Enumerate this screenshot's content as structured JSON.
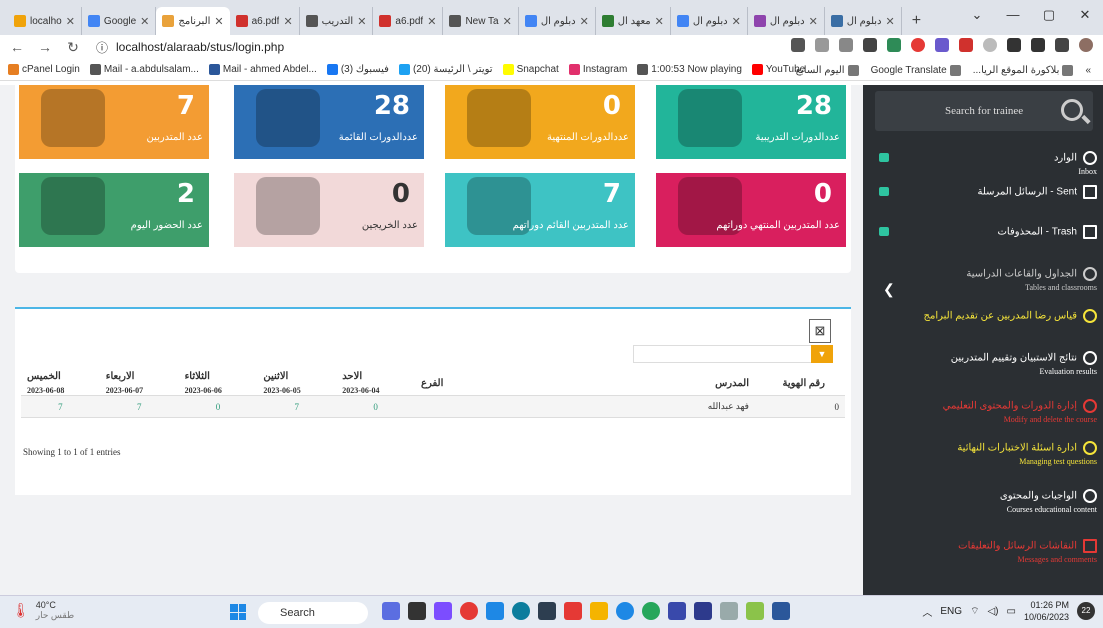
{
  "browser": {
    "tabs": [
      {
        "label": "localho",
        "color": "#f0a30a",
        "active": false
      },
      {
        "label": "Google",
        "color": "#4285f4",
        "active": false
      },
      {
        "label": "البرنامج",
        "color": "#e9a23b",
        "active": true
      },
      {
        "label": "a6.pdf",
        "color": "#d0312d",
        "active": false
      },
      {
        "label": "التدريب",
        "color": "#555",
        "active": false
      },
      {
        "label": "a6.pdf",
        "color": "#d0312d",
        "active": false
      },
      {
        "label": "New Ta",
        "color": "#555",
        "active": false
      },
      {
        "label": "دبلوم ال",
        "color": "#4285f4",
        "active": false
      },
      {
        "label": "معهد ال",
        "color": "#2e7d32",
        "active": false
      },
      {
        "label": "دبلوم ال",
        "color": "#4285f4",
        "active": false
      },
      {
        "label": "دبلوم ال",
        "color": "#8e44ad",
        "active": false
      },
      {
        "label": "دبلوم ال",
        "color": "#3a6ea5",
        "active": false
      }
    ],
    "new_tab": "+",
    "url": "localhost/alaraab/stus/login.php",
    "bookmarks_left": [
      "cPanel Login",
      "Mail - a.abdulsalam...",
      "Mail - ahmed Abdel...",
      "(3) فيسبوك",
      "(20) تويتر \\ الرئيسة",
      "Snapchat",
      "Instagram",
      "1:00:53 Now playing",
      "YouTube"
    ],
    "bookmarks_right": [
      "بلاكورة الموقع الريا...",
      "Google Translate",
      "اليوم السابع"
    ],
    "bookmarks_more": "»"
  },
  "cards": [
    {
      "id": "trainees",
      "value": "7",
      "label": "عدد المتدربين",
      "color": "#f39c33"
    },
    {
      "id": "current-courses",
      "value": "28",
      "label": "عددالدورات القائمة",
      "color": "#2c6fb5"
    },
    {
      "id": "finished-courses",
      "value": "0",
      "label": "عددالدورات المنتهية",
      "color": "#f2a81d"
    },
    {
      "id": "training-courses",
      "value": "28",
      "label": "عددالدورات التدريبية",
      "color": "#22b59a"
    },
    {
      "id": "attendance-today",
      "value": "2",
      "label": "عدد الحضور اليوم",
      "color": "#3e9e6b"
    },
    {
      "id": "graduates",
      "value": "0",
      "label": "عدد الخريجين",
      "color": "#f2d9d9"
    },
    {
      "id": "trainees-current",
      "value": "7",
      "label": "عدد المتدربين القائم دوراتهم",
      "color": "#3ec3c4"
    },
    {
      "id": "trainees-finished",
      "value": "0",
      "label": "عدد المتدربين المنتهي دوراتهم",
      "color": "#d91f5e"
    }
  ],
  "table": {
    "headers": {
      "id": "رقم الهوية",
      "teacher": "المدرس",
      "branch": "الفرع"
    },
    "days": [
      {
        "name": "الخميس",
        "date": "2023-06-08"
      },
      {
        "name": "الاربعاء",
        "date": "2023-06-07"
      },
      {
        "name": "الثلاثاء",
        "date": "2023-06-06"
      },
      {
        "name": "الاثنين",
        "date": "2023-06-05"
      },
      {
        "name": "الاحد",
        "date": "2023-06-04"
      }
    ],
    "row": {
      "thu": "7",
      "wed": "7",
      "tue": "0",
      "mon": "7",
      "sun": "0",
      "branch": "",
      "teacher": "فهد عبدالله",
      "id": "0"
    },
    "showing": "Showing 1 to 1 of 1 entries"
  },
  "sidebar": {
    "search_placeholder": "Search for trainee",
    "items": [
      {
        "ar": "الوارد",
        "en": "Inbox",
        "inline": true,
        "color": "#fff"
      },
      {
        "ar": "Sent - الرسائل المرسلة",
        "en": "",
        "inline": true,
        "color": "#fff"
      },
      {
        "ar": "Trash - المحذوفات",
        "en": "",
        "inline": true,
        "color": "#fff"
      },
      {
        "ar": "الجداول والقاعات الدراسية",
        "en": "Tables and classrooms",
        "color": "#ccc"
      },
      {
        "ar": "قياس رضا المدربين عن تقديم البرامج",
        "en": "",
        "color": "#f5e43a"
      },
      {
        "ar": "نتائج الاستبيان وتقييم المتدربين",
        "en": "Evaluation results",
        "color": "#fff"
      },
      {
        "ar": "إدارة الدورات والمحتوى التعليمي",
        "en": "Modify and delete the course",
        "color": "#e53935"
      },
      {
        "ar": "ادارة اسئلة الاختبارات النهائية",
        "en": "Managing test questions",
        "color": "#f5e43a"
      },
      {
        "ar": "الواجبات والمحتوى",
        "en": "Courses educational content",
        "color": "#fff"
      },
      {
        "ar": "النقاشات الرسائل والتعليقات",
        "en": "Messages and comments",
        "color": "#e53935"
      }
    ]
  },
  "taskbar": {
    "temp": "40°C",
    "weather": "طقس حار",
    "search": "Search",
    "lang": "ENG",
    "time": "01:26 PM",
    "date": "10/06/2023",
    "notif": "22"
  }
}
